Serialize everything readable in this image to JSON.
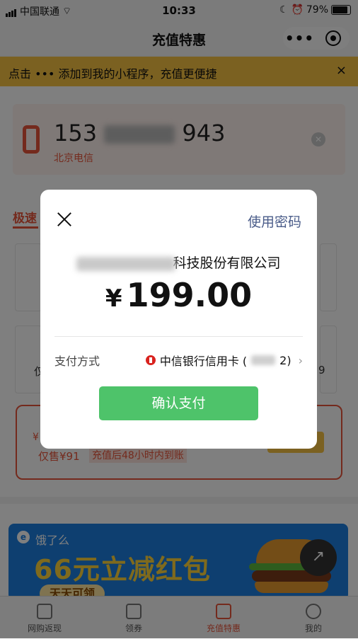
{
  "status_bar": {
    "carrier": "中国联通",
    "time": "10:33",
    "battery_percent": "79%",
    "battery_level": 0.79
  },
  "nav": {
    "title": "充值特惠",
    "more_icon": "more-dots-icon",
    "target_icon": "miniprogram-target-icon"
  },
  "banner": {
    "text_prefix": "点击",
    "dots": "•••",
    "text_suffix": "添加到我的小程序，充值更便捷",
    "close": "×"
  },
  "phone": {
    "number_prefix": "153",
    "number_suffix": "943",
    "carrier": "北京电信"
  },
  "tabs": {
    "active_label": "极速"
  },
  "tiles": {
    "left_fragment": "仅",
    "right_fragment": "9"
  },
  "offer": {
    "price_top": "¥",
    "price": "仅售¥91",
    "tag": "充值后48小时内到账"
  },
  "ad": {
    "brand": "饿了么",
    "title": "66元立减红包",
    "subtitle": "天天可领"
  },
  "tabbar": [
    {
      "label": "网购返现",
      "icon": "shopping-bag-icon"
    },
    {
      "label": "领券",
      "icon": "coupon-icon"
    },
    {
      "label": "充值特惠",
      "icon": "phone-icon"
    },
    {
      "label": "我的",
      "icon": "user-icon"
    }
  ],
  "dialog": {
    "use_password": "使用密码",
    "merchant_suffix": "科技股份有限公司",
    "currency": "¥",
    "amount": "199.00",
    "pay_method_label": "支付方式",
    "pay_method_bank": "中信银行信用卡 (",
    "pay_method_card_end": "2)",
    "confirm": "确认支付"
  },
  "colors": {
    "accent": "#e8543a",
    "confirm_green": "#4ec36a",
    "banner_yellow": "#f6c343",
    "link_blue": "#4a5c89"
  }
}
